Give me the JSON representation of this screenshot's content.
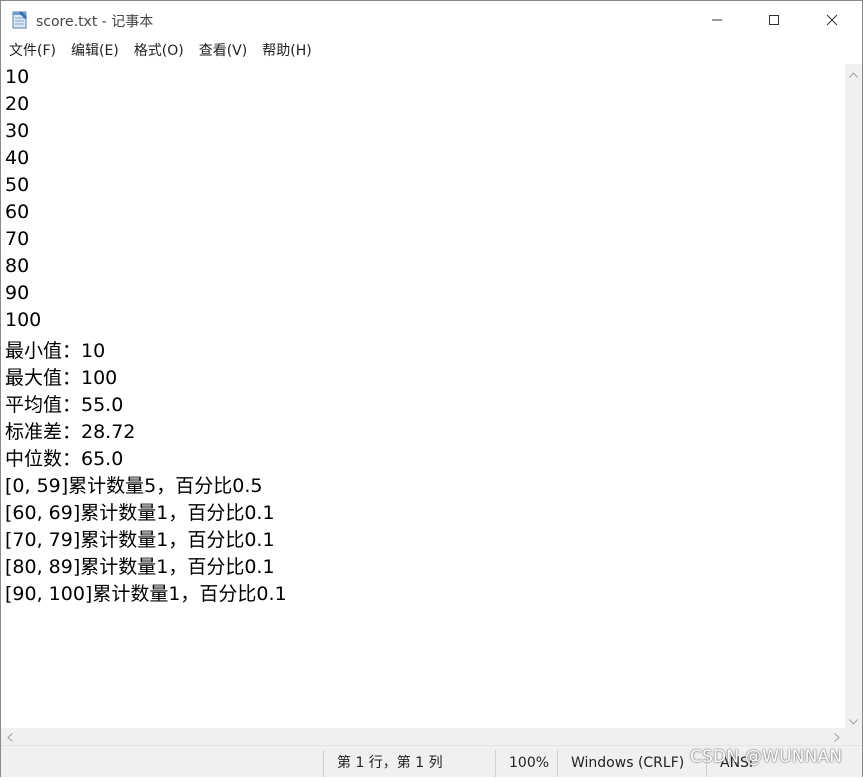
{
  "window": {
    "title": "score.txt - 记事本",
    "icon": "notepad-icon"
  },
  "titlebar_buttons": {
    "minimize_icon": "minimize-icon",
    "maximize_icon": "maximize-icon",
    "close_icon": "close-icon"
  },
  "menu": {
    "items": [
      "文件(F)",
      "编辑(E)",
      "格式(O)",
      "查看(V)",
      "帮助(H)"
    ]
  },
  "editor": {
    "lines": [
      "10",
      "20",
      "30",
      "40",
      "50",
      "60",
      "70",
      "80",
      "90",
      "100",
      "最小值：10",
      "最大值：100",
      "平均值：55.0",
      "标准差：28.72",
      "中位数：65.0",
      "[0, 59]累计数量5，百分比0.5",
      "[60, 69]累计数量1，百分比0.1",
      "[70, 79]累计数量1，百分比0.1",
      "[80, 89]累计数量1，百分比0.1",
      "[90, 100]累计数量1，百分比0.1"
    ]
  },
  "statusbar": {
    "position": "第 1 行，第 1 列",
    "zoom": "100%",
    "line_ending": "Windows (CRLF)",
    "encoding": "ANSI"
  },
  "watermark": "CSDN @WUNNAN",
  "colors": {
    "statusbar_bg": "#f0f0f0",
    "text": "#000000"
  }
}
